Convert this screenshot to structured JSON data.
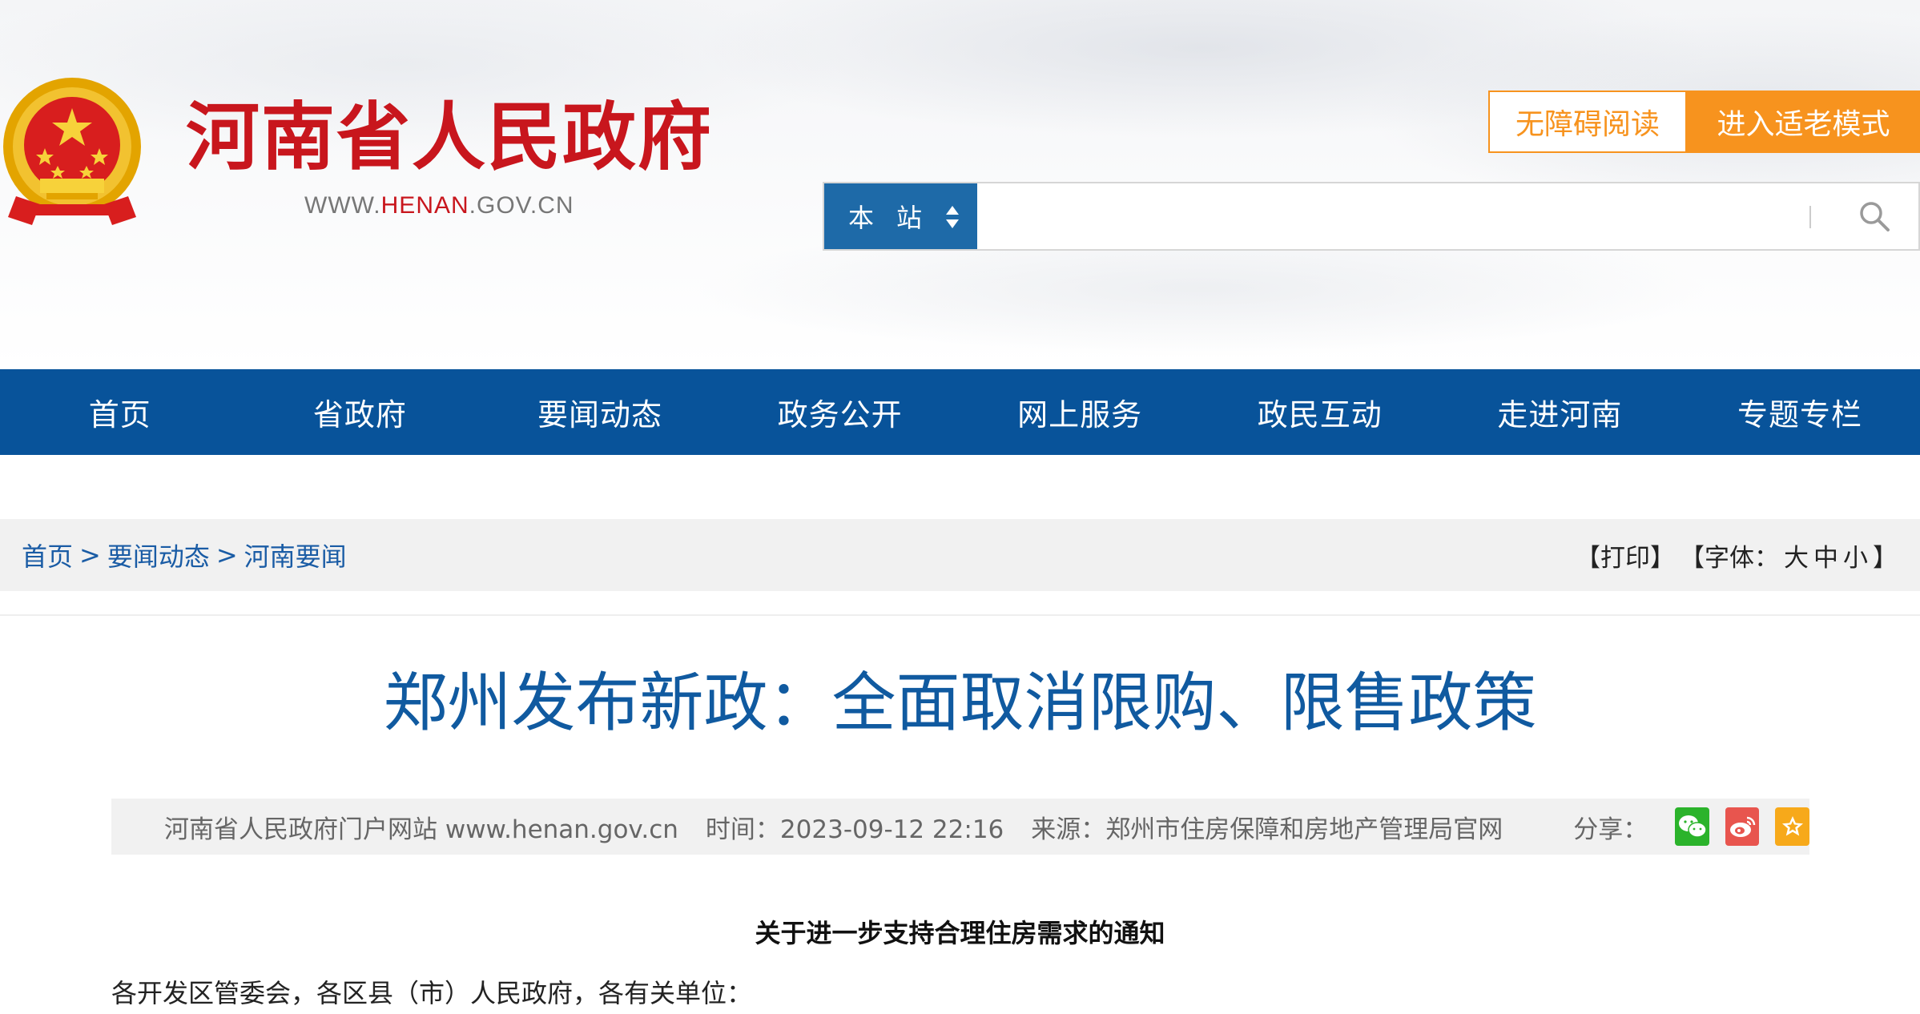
{
  "header": {
    "site_title": "河南省人民政府",
    "site_url_prefix": "WWW.",
    "site_url_highlight": "HENAN",
    "site_url_suffix": ".GOV.CN",
    "accessibility_label": "无障碍阅读",
    "elder_mode_label": "进入适老模式",
    "search": {
      "scope_label": "本站",
      "placeholder": ""
    },
    "colors": {
      "brand_red": "#c8161d",
      "accent_orange": "#f7931e",
      "scope_blue": "#1e6aa8"
    }
  },
  "nav": {
    "items": [
      "首页",
      "省政府",
      "要闻动态",
      "政务公开",
      "网上服务",
      "政民互动",
      "走进河南",
      "专题专栏"
    ],
    "background": "#08539a"
  },
  "breadcrumb": {
    "items": [
      "首页",
      "要闻动态",
      "河南要闻"
    ],
    "separator": ">"
  },
  "tools": {
    "print": "【打印】",
    "font_prefix": "【字体：",
    "font_large": "大",
    "font_medium": "中",
    "font_small": "小",
    "font_suffix": "】"
  },
  "article": {
    "title": "郑州发布新政：全面取消限购、限售政策",
    "meta": {
      "site": "河南省人民政府门户网站 www.henan.gov.cn",
      "time": "时间：2023-09-12 22:16",
      "source": "来源：郑州市住房保障和房地产管理局官网",
      "share_label": "分享："
    },
    "doc_heading": "关于进一步支持合理住房需求的通知",
    "first_paragraph": "各开发区管委会，各区县（市）人民政府，各有关单位："
  }
}
